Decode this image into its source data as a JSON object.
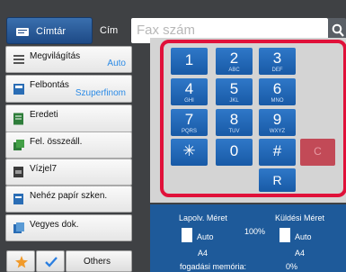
{
  "header": {
    "cimtar_label": "Címtár",
    "cim_label": "Cím",
    "fax_placeholder": "Fax szám",
    "search_icon": "search-icon"
  },
  "settings": [
    {
      "label": "Megvilágítás",
      "value": "Auto"
    },
    {
      "label": "Felbontás",
      "value": "Szuperfinom"
    },
    {
      "label": "Eredeti",
      "value": ""
    },
    {
      "label": "Fel. összeáll.",
      "value": ""
    },
    {
      "label": "Vízjel7",
      "value": ""
    },
    {
      "label": "Nehéz papír szken.",
      "value": ""
    },
    {
      "label": "Vegyes dok.",
      "value": ""
    }
  ],
  "keypad": {
    "keys": [
      {
        "num": "1",
        "sub": ""
      },
      {
        "num": "2",
        "sub": "ABC"
      },
      {
        "num": "3",
        "sub": "DEF"
      },
      {
        "num": "4",
        "sub": "GHI"
      },
      {
        "num": "5",
        "sub": "JKL"
      },
      {
        "num": "6",
        "sub": "MNO"
      },
      {
        "num": "7",
        "sub": "PQRS"
      },
      {
        "num": "8",
        "sub": "TUV"
      },
      {
        "num": "9",
        "sub": "WXYZ"
      },
      {
        "num": "✳",
        "sub": ""
      },
      {
        "num": "0",
        "sub": ""
      },
      {
        "num": "#",
        "sub": ""
      }
    ],
    "clear_label": "C",
    "redial_label": "R"
  },
  "footer": {
    "favorite_icon": "star-icon",
    "check_icon": "check-icon",
    "others_label": "Others"
  },
  "info": {
    "original_size_label": "Lapolv. Méret",
    "send_size_label": "Küldési Méret",
    "original_size_value": "Auto",
    "original_paper": "A4",
    "ratio": "100%",
    "send_size_value": "Auto",
    "send_paper": "A4",
    "memory_label": "fogadási memória:",
    "memory_value": "0%"
  },
  "colors": {
    "accent_blue": "#2a6db5",
    "highlight_frame": "#e0113a"
  }
}
